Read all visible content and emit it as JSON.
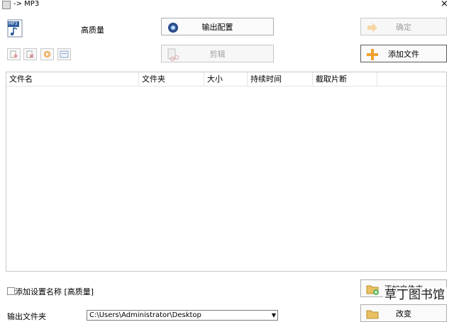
{
  "window": {
    "title": "-> MP3",
    "close_label": "×"
  },
  "format": {
    "icon_text": "MP3",
    "quality_label": "高质量"
  },
  "buttons": {
    "output_config": "输出配置",
    "ok": "确定",
    "clip": "剪辑",
    "add_file": "添加文件",
    "add_folder": "添加文件夹",
    "change": "改变"
  },
  "table": {
    "columns": [
      "文件名",
      "文件夹",
      "大小",
      "持续时间",
      "截取片断"
    ]
  },
  "options": {
    "append_setting_name": "添加设置名称 [高质量]"
  },
  "output": {
    "label": "输出文件夹",
    "path": "C:\\Users\\Administrator\\Desktop"
  },
  "watermark": {
    "text": "草丁图书馆"
  },
  "colors": {
    "accent_orange": "#f0a030",
    "disabled_text": "#a0a0a0"
  }
}
